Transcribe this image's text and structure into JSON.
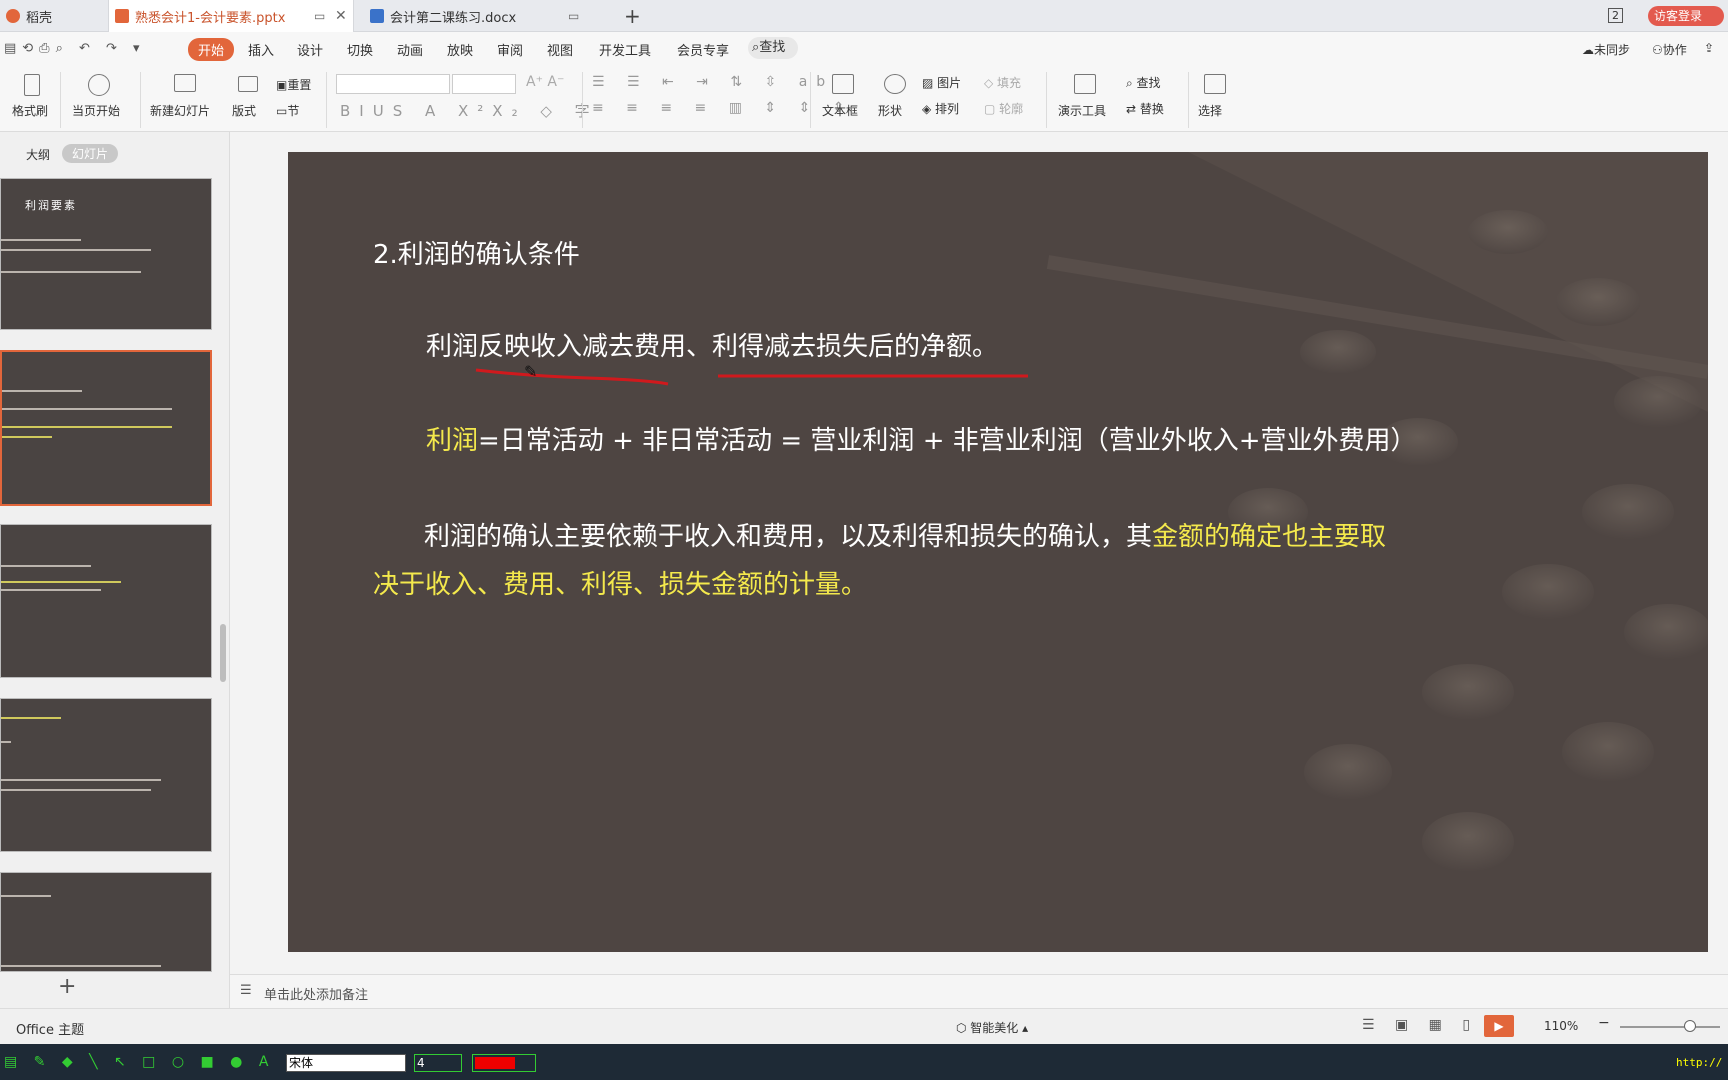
{
  "tabs": [
    {
      "label": "稻壳"
    },
    {
      "label": "熟悉会计1-会计要素.pptx"
    },
    {
      "label": "会计第二课练习.docx"
    }
  ],
  "titlebar": {
    "new_tab": "+",
    "window_count": "2",
    "login_button": "访客登录"
  },
  "menu": [
    "开始",
    "插入",
    "设计",
    "切换",
    "动画",
    "放映",
    "审阅",
    "视图",
    "开发工具",
    "会员专享",
    "查找"
  ],
  "menu_right": {
    "sync": "未同步",
    "collab": "协作"
  },
  "ribbon": {
    "format_brush": "格式刷",
    "from_current": "当页开始",
    "new_slide": "新建幻灯片",
    "layout": "版式",
    "reset": "重置",
    "section": "节",
    "textbox": "文本框",
    "shape": "形状",
    "picture": "图片",
    "fill": "填充",
    "arrange": "排列",
    "outline": "轮廓",
    "present_tools": "演示工具",
    "find": "查找",
    "replace": "替换",
    "select": "选择"
  },
  "leftpane": {
    "outline_tab": "大纲",
    "slides_tab": "幻灯片",
    "thumb1_title": "利润要素",
    "add": "+"
  },
  "slide": {
    "heading": "2.利润的确认条件",
    "line1": "利润反映收入减去费用、利得减去损失后的净额。",
    "line2_label": "利润",
    "line2_rest": "=日常活动 + 非日常活动 = 营业利润 + 非营业利润（营业外收入+营业外费用）",
    "line3_white": "利润的确认主要依赖于收入和费用，以及利得和损失的确认，其",
    "line3_yellow": "金额的确定也主要取",
    "line4_yellow": "决于收入、费用、利得、损失金额的计量。"
  },
  "notes": {
    "placeholder": "单击此处添加备注"
  },
  "status": {
    "theme": "Office 主题",
    "beautify": "智能美化",
    "zoom": "110%"
  },
  "taskbar": {
    "font": "宋体",
    "size": "4",
    "url": "http://"
  },
  "colors": {
    "accent": "#e2663b",
    "slide_bg": "#4e4542",
    "highlight_yellow": "#f4e94c",
    "underline_red": "#d0191d"
  }
}
